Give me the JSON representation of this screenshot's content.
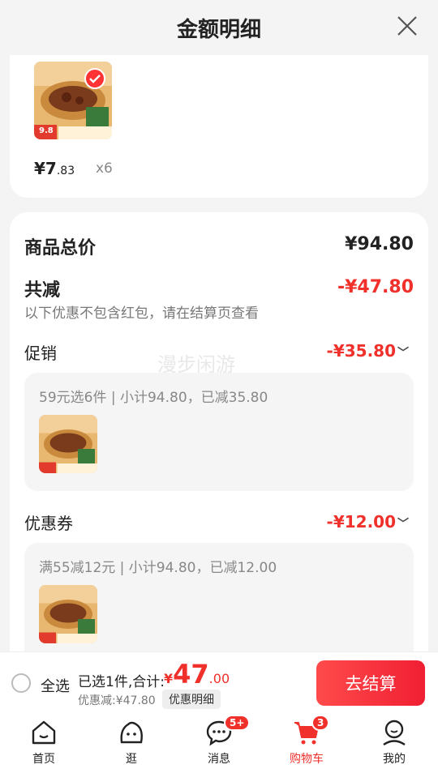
{
  "header": {
    "title": "金额明细"
  },
  "item": {
    "price_int": "¥7",
    "price_dec": ".83",
    "qty": "x6",
    "badge_price": "9.8"
  },
  "summary": {
    "total_label": "商品总价",
    "total_value": "¥94.80",
    "reduce_label": "共减",
    "reduce_value": "-¥47.80",
    "note": "以下优惠不包含红包，请在结算页查看",
    "promo_label": "促销",
    "promo_value": "-¥35.80",
    "promo_desc": "59元选6件 | 小计94.80，已减35.80",
    "coupon_label": "优惠券",
    "coupon_value": "-¥12.00",
    "coupon_desc": "满55减12元 | 小计94.80，已减12.00",
    "watermark": "漫步闲游"
  },
  "footer": {
    "select_all": "全选",
    "selected_text": "已选1件,合计:",
    "total_cur": "¥",
    "total_int": "47",
    "total_dec": ".00",
    "discount_text": "优惠减:¥47.80",
    "detail_button": "优惠明细",
    "checkout_button": "去结算"
  },
  "tabbar": {
    "home": "首页",
    "browse": "逛",
    "messages": "消息",
    "messages_badge": "5+",
    "cart": "购物车",
    "cart_badge": "3",
    "mine": "我的"
  },
  "colors": {
    "accent": "#f0302a",
    "background": "#f4f4f4"
  }
}
